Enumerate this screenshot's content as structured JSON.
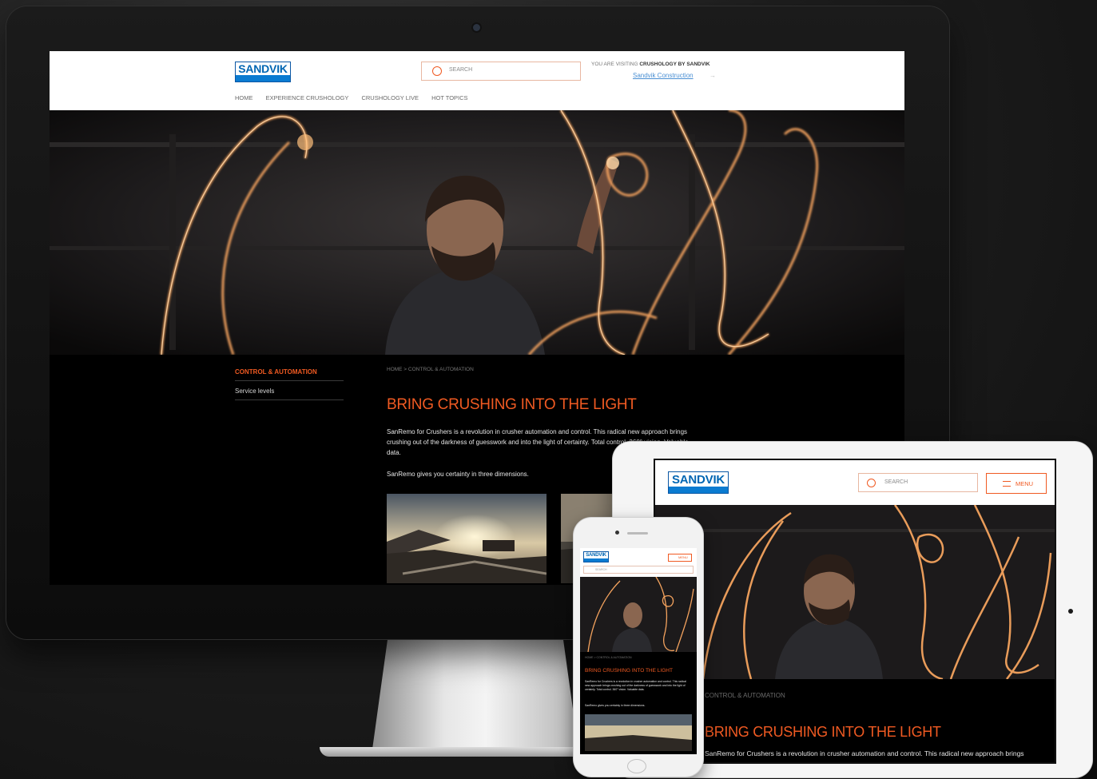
{
  "brand": {
    "logo_text": "SANDVIK",
    "colors": {
      "accent": "#f05a22",
      "brand_blue": "#0a7bd1",
      "background": "#000000"
    }
  },
  "header": {
    "search_placeholder": "SEARCH",
    "visiting_prefix": "YOU ARE VISITING",
    "visiting_site": "CRUSHOLOGY BY SANDVIK",
    "site_link": "Sandvik Construction",
    "site_link_icon": "arrow-right-icon"
  },
  "nav": {
    "items": [
      {
        "label": "HOME"
      },
      {
        "label": "EXPERIENCE CRUSHOLOGY"
      },
      {
        "label": "CRUSHOLOGY LIVE"
      },
      {
        "label": "HOT TOPICS"
      }
    ]
  },
  "sidebar": {
    "title": "CONTROL & AUTOMATION",
    "items": [
      {
        "label": "Service levels"
      }
    ]
  },
  "breadcrumb": "HOME > CONTROL & AUTOMATION",
  "article": {
    "title": "BRING CRUSHING INTO THE LIGHT",
    "intro": "SanRemo for Crushers is a revolution in crusher automation and control. This radical new approach brings crushing out of the darkness of guesswork and into the light of certainty. Total control. 360° vision. Valuable data.",
    "subline": "SanRemo gives you certainty in three dimensions."
  },
  "tablet": {
    "search_placeholder": "SEARCH",
    "menu_label": "MENU",
    "sidebar_title": "CONTROL & AUTOMATION",
    "title": "BRING CRUSHING INTO THE LIGHT",
    "intro": "SanRemo for Crushers is a revolution in crusher automation and control. This radical new approach brings"
  },
  "phone": {
    "menu_label": "MENU",
    "search_placeholder": "SEARCH",
    "breadcrumb": "HOME > CONTROL & AUTOMATION",
    "title": "BRING CRUSHING INTO THE LIGHT",
    "intro": "SanRemo for Crushers is a revolution in crusher automation and control. This radical new approach brings crushing out of the darkness of guesswork and into the light of certainty. Total control. 360° vision. Valuable data.",
    "subline": "SanRemo gives you certainty in three dimensions."
  }
}
